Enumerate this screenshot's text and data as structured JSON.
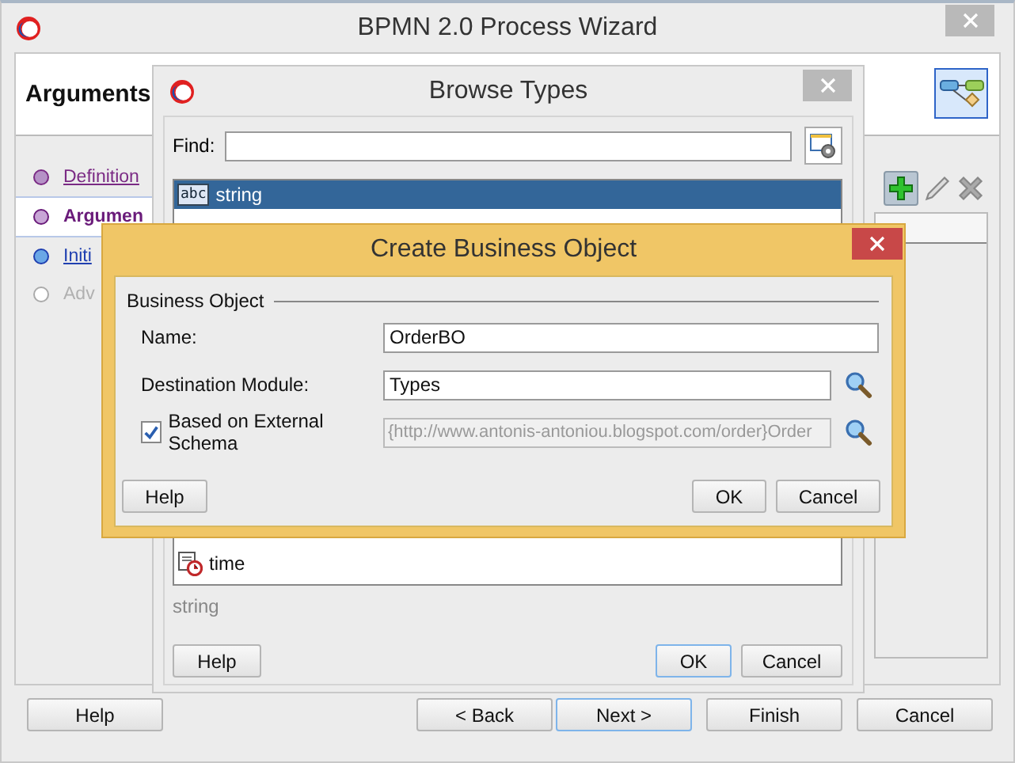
{
  "window": {
    "title": "BPMN 2.0 Process Wizard"
  },
  "header": {
    "title": "Arguments"
  },
  "steps": [
    {
      "label": "Definition",
      "kind": "visited",
      "selected": false
    },
    {
      "label": "Argumen",
      "kind": "current",
      "selected": true
    },
    {
      "label": "Initi",
      "kind": "available",
      "selected": false
    },
    {
      "label": "Adv",
      "kind": "disabled",
      "selected": false
    }
  ],
  "wizard_buttons": [
    {
      "label": "Help",
      "focused": false
    },
    {
      "label": "< Back",
      "focused": false
    },
    {
      "label": "Next >",
      "focused": true
    },
    {
      "label": "Finish",
      "focused": false
    },
    {
      "label": "Cancel",
      "focused": false
    }
  ],
  "browse_dialog": {
    "title": "Browse Types",
    "find_label": "Find:",
    "types": [
      {
        "name": "string",
        "kind": "text",
        "icon_text": "abc",
        "selected": true
      },
      {
        "name": "time",
        "kind": "datetime",
        "selected": false
      }
    ],
    "selection_label": "string",
    "buttons": [
      {
        "label": "Help",
        "focused": false
      },
      {
        "label": "OK",
        "focused": true
      },
      {
        "label": "Cancel",
        "focused": false
      }
    ]
  },
  "create_dialog": {
    "title": "Create Business Object",
    "section": "Business Object",
    "name_label": "Name:",
    "name_value": "OrderBO",
    "module_label": "Destination Module:",
    "module_value": "Types",
    "external_schema": {
      "label": "Based on External Schema",
      "checked": true,
      "value": "{http://www.antonis-antoniou.blogspot.com/order}Order",
      "disabled": true
    },
    "buttons": [
      {
        "label": "Help",
        "focused": false
      },
      {
        "label": "OK",
        "focused": false
      },
      {
        "label": "Cancel",
        "focused": false
      }
    ]
  }
}
